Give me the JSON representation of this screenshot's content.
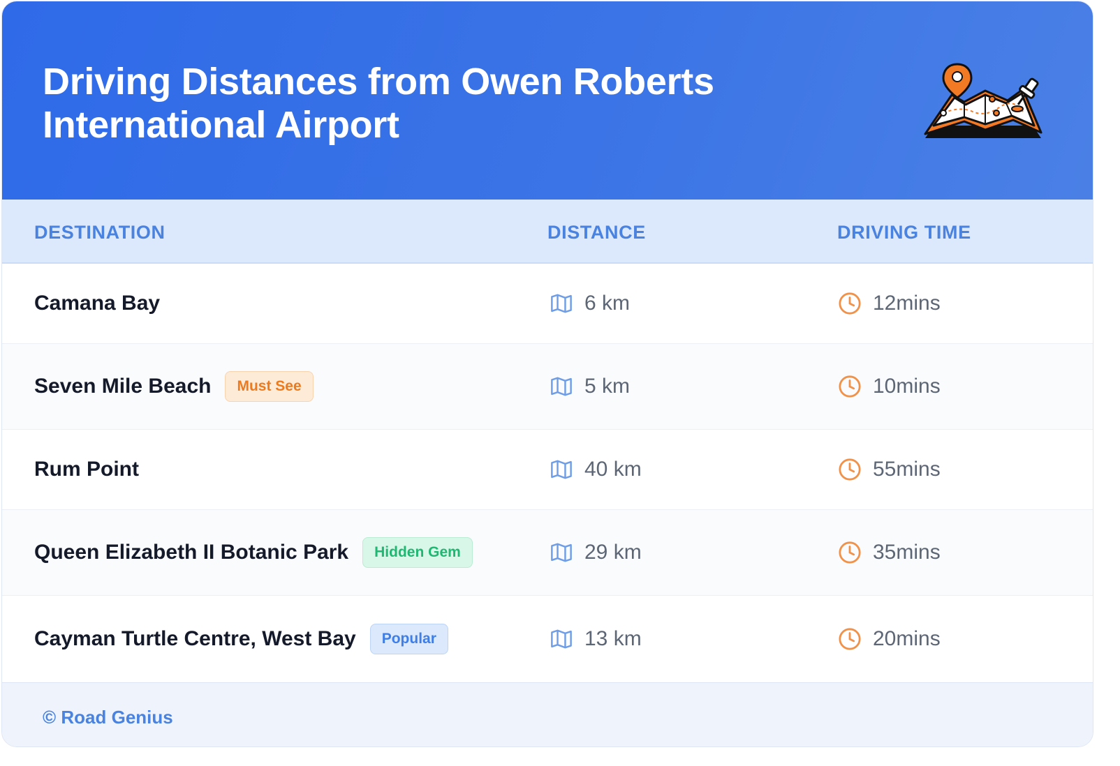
{
  "header": {
    "title_line1": "Driving Distances from Owen Roberts",
    "title_line2": "International Airport",
    "illustration_icon": "map-pin-illustration"
  },
  "columns": {
    "destination": "DESTINATION",
    "distance": "DISTANCE",
    "driving_time": "DRIVING TIME"
  },
  "rows": [
    {
      "destination": "Camana Bay",
      "badge": "",
      "distance": "6 km",
      "time": "12mins"
    },
    {
      "destination": "Seven Mile Beach",
      "badge": "Must See",
      "badge_color": "#ec7a1f",
      "distance": "5 km",
      "time": "10mins"
    },
    {
      "destination": "Rum Point",
      "badge": "",
      "distance": "40 km",
      "time": "55mins"
    },
    {
      "destination": "Queen Elizabeth II Botanic Park",
      "badge": "Hidden Gem",
      "badge_color": "#1fb772",
      "distance": "29 km",
      "time": "35mins"
    },
    {
      "destination": "Cayman Turtle Centre, West Bay",
      "badge": "Popular",
      "badge_color": "#3f7ee6",
      "distance": "13 km",
      "time": "20mins"
    }
  ],
  "icons": {
    "distance": "map-icon",
    "time": "clock-icon"
  },
  "footer": {
    "credit": "© Road Genius"
  },
  "colors": {
    "header_gradient_start": "#2f6ae8",
    "header_gradient_end": "#4a80e6",
    "column_header_text": "#4a82e0",
    "map_icon": "#6f9ee6",
    "clock_icon": "#f0924a"
  }
}
